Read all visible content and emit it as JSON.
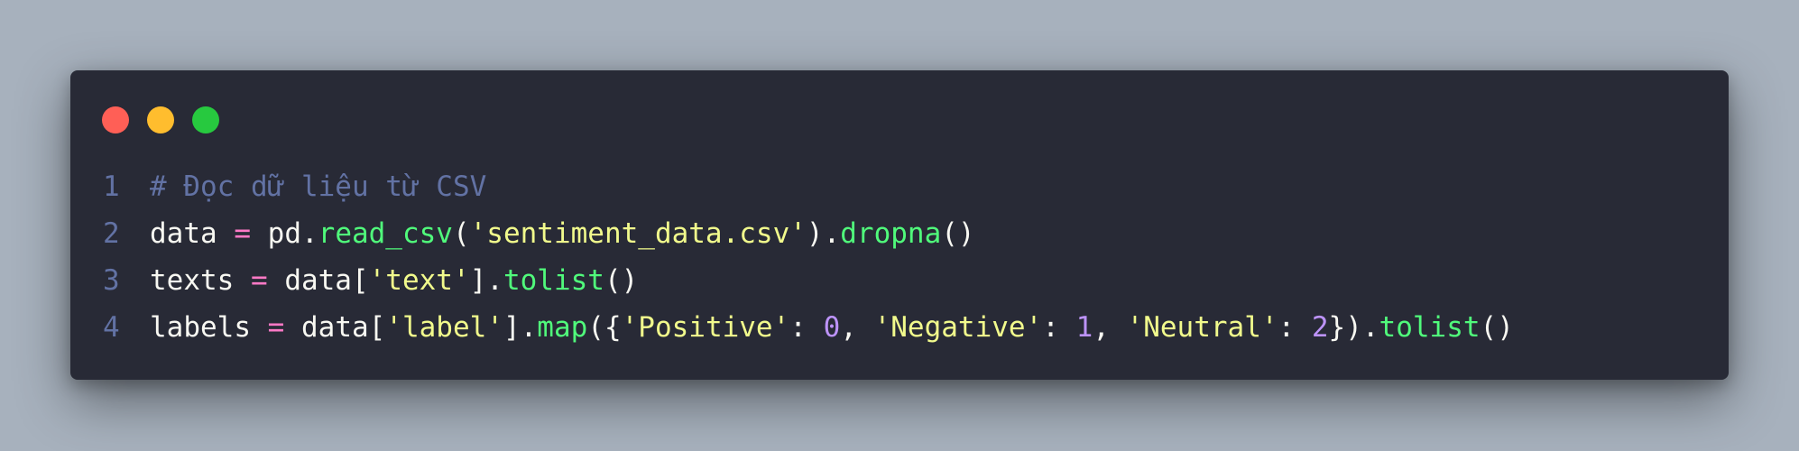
{
  "colors": {
    "background": "#a7b1bd",
    "window": "#282a36",
    "dot_close": "#ff5f56",
    "dot_minimize": "#ffbd2e",
    "dot_maximize": "#27c93f"
  },
  "code": {
    "lines": [
      {
        "number": "1",
        "tokens": [
          {
            "t": "comment",
            "v": "# Đọc dữ liệu từ CSV"
          }
        ]
      },
      {
        "number": "2",
        "tokens": [
          {
            "t": "plain",
            "v": "data "
          },
          {
            "t": "op",
            "v": "="
          },
          {
            "t": "plain",
            "v": " pd."
          },
          {
            "t": "fn",
            "v": "read_csv"
          },
          {
            "t": "plain",
            "v": "("
          },
          {
            "t": "str",
            "v": "'sentiment_data.csv'"
          },
          {
            "t": "plain",
            "v": ")."
          },
          {
            "t": "fn",
            "v": "dropna"
          },
          {
            "t": "plain",
            "v": "()"
          }
        ]
      },
      {
        "number": "3",
        "tokens": [
          {
            "t": "plain",
            "v": "texts "
          },
          {
            "t": "op",
            "v": "="
          },
          {
            "t": "plain",
            "v": " data["
          },
          {
            "t": "str",
            "v": "'text'"
          },
          {
            "t": "plain",
            "v": "]."
          },
          {
            "t": "fn",
            "v": "tolist"
          },
          {
            "t": "plain",
            "v": "()"
          }
        ]
      },
      {
        "number": "4",
        "tokens": [
          {
            "t": "plain",
            "v": "labels "
          },
          {
            "t": "op",
            "v": "="
          },
          {
            "t": "plain",
            "v": " data["
          },
          {
            "t": "str",
            "v": "'label'"
          },
          {
            "t": "plain",
            "v": "]."
          },
          {
            "t": "fn",
            "v": "map"
          },
          {
            "t": "plain",
            "v": "({"
          },
          {
            "t": "str",
            "v": "'Positive'"
          },
          {
            "t": "plain",
            "v": ": "
          },
          {
            "t": "num",
            "v": "0"
          },
          {
            "t": "plain",
            "v": ", "
          },
          {
            "t": "str",
            "v": "'Negative'"
          },
          {
            "t": "plain",
            "v": ": "
          },
          {
            "t": "num",
            "v": "1"
          },
          {
            "t": "plain",
            "v": ", "
          },
          {
            "t": "str",
            "v": "'Neutral'"
          },
          {
            "t": "plain",
            "v": ": "
          },
          {
            "t": "num",
            "v": "2"
          },
          {
            "t": "plain",
            "v": "})."
          },
          {
            "t": "fn",
            "v": "tolist"
          },
          {
            "t": "plain",
            "v": "()"
          }
        ]
      }
    ]
  }
}
